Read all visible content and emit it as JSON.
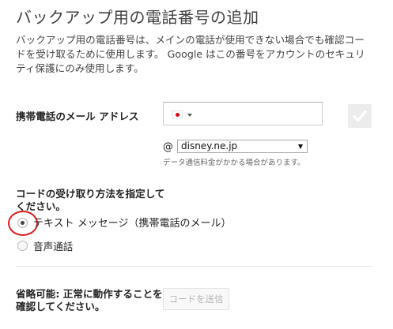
{
  "page": {
    "title": "バックアップ用の電話番号の追加",
    "description": "バックアップ用の電話番号は、メインの電話が使用できない場合でも確認コードを受け取るために使用します。 Google はこの番号をアカウントのセキュリティ保護にのみ使用します。"
  },
  "phone": {
    "label": "携帯電話のメール アドレス",
    "country_icon": "japan-flag-icon",
    "value": "",
    "confirm_icon": "checkmark-icon"
  },
  "email_domain": {
    "at_symbol": "@",
    "selected": "disney.ne.jp",
    "note": "データ通信料金がかかる場合があります。"
  },
  "delivery_method": {
    "label": "コードの受け取り方法を指定してください。",
    "options": [
      {
        "label": "テキスト メッセージ（携帯電話のメール）",
        "selected": true
      },
      {
        "label": "音声通話",
        "selected": false
      }
    ]
  },
  "verify": {
    "label": "省略可能: 正常に動作することを確認してください。",
    "button_label": "コードを送信"
  },
  "colors": {
    "highlight": "#e21c1c",
    "flag_red": "#d7000f",
    "disabled_text": "#b6b6b6"
  }
}
